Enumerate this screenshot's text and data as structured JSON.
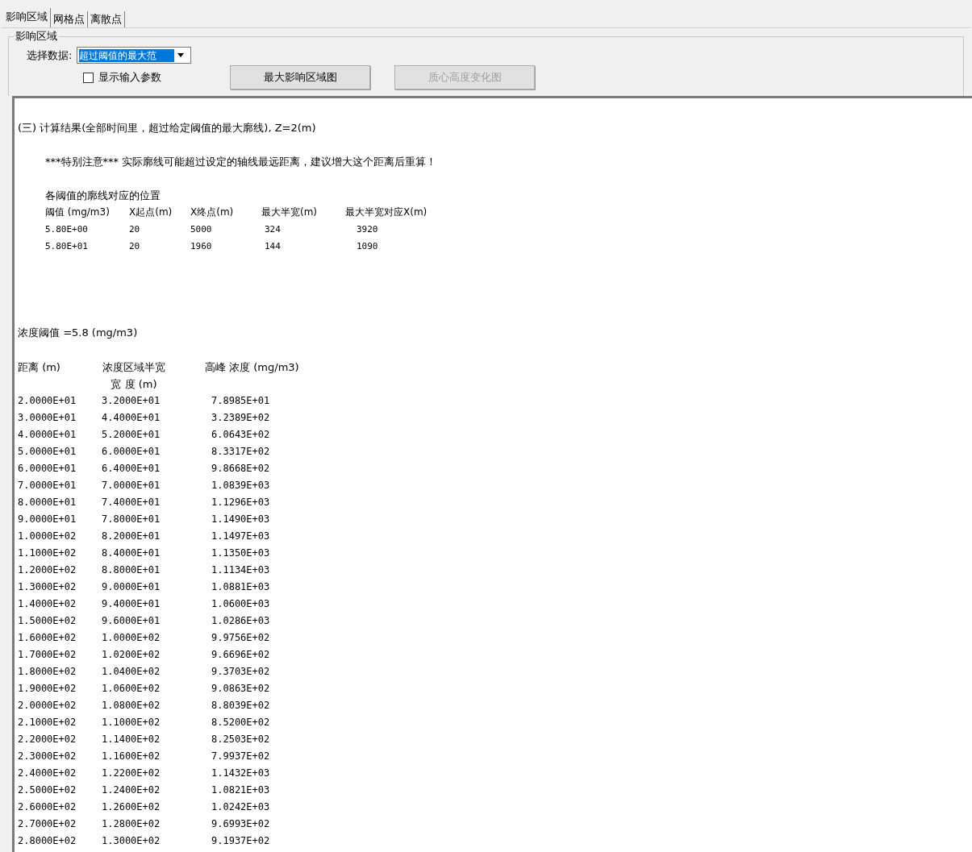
{
  "tabs": [
    {
      "label": "影响区域",
      "selected": true
    },
    {
      "label": "网格点",
      "selected": false
    },
    {
      "label": "离散点",
      "selected": false
    }
  ],
  "group": {
    "title": "影响区域",
    "select_label": "选择数据:",
    "select_value": "超过阈值的最大范",
    "checkbox": {
      "label": "显示输入参数",
      "checked": false
    },
    "buttons": [
      {
        "label": "最大影响区域图",
        "disabled": false
      },
      {
        "label": "质心高度变化图",
        "disabled": true
      }
    ]
  },
  "output": {
    "heading": "(三) 计算结果(全部时间里，超过给定阈值的最大廓线), Z=2(m)",
    "note": "***特别注意*** 实际廓线可能超过设定的轴线最远距离，建议增大这个距离后重算！",
    "threshold_table": {
      "title": "各阈值的廓线对应的位置",
      "columns": [
        "阈值 (mg/m3)",
        "X起点(m)",
        "X终点(m)",
        "最大半宽(m)",
        "最大半宽对应X(m)"
      ],
      "rows": [
        [
          "5.80E+00",
          "20",
          "5000",
          "324",
          "3920"
        ],
        [
          "5.80E+01",
          "20",
          "1960",
          "144",
          "1090"
        ]
      ]
    },
    "concentration_title": "浓度阈值 =5.8 (mg/m3)",
    "concentration_table": {
      "columns": [
        "距离 (m)",
        "浓度区域半宽宽 度 (m)",
        "高峰 浓度 (mg/m3)"
      ],
      "rows": [
        [
          "2.0000E+01",
          "3.2000E+01",
          "7.8985E+01"
        ],
        [
          "3.0000E+01",
          "4.4000E+01",
          "3.2389E+02"
        ],
        [
          "4.0000E+01",
          "5.2000E+01",
          "6.0643E+02"
        ],
        [
          "5.0000E+01",
          "6.0000E+01",
          "8.3317E+02"
        ],
        [
          "6.0000E+01",
          "6.4000E+01",
          "9.8668E+02"
        ],
        [
          "7.0000E+01",
          "7.0000E+01",
          "1.0839E+03"
        ],
        [
          "8.0000E+01",
          "7.4000E+01",
          "1.1296E+03"
        ],
        [
          "9.0000E+01",
          "7.8000E+01",
          "1.1490E+03"
        ],
        [
          "1.0000E+02",
          "8.2000E+01",
          "1.1497E+03"
        ],
        [
          "1.1000E+02",
          "8.4000E+01",
          "1.1350E+03"
        ],
        [
          "1.2000E+02",
          "8.8000E+01",
          "1.1134E+03"
        ],
        [
          "1.3000E+02",
          "9.0000E+01",
          "1.0881E+03"
        ],
        [
          "1.4000E+02",
          "9.4000E+01",
          "1.0600E+03"
        ],
        [
          "1.5000E+02",
          "9.6000E+01",
          "1.0286E+03"
        ],
        [
          "1.6000E+02",
          "1.0000E+02",
          "9.9756E+02"
        ],
        [
          "1.7000E+02",
          "1.0200E+02",
          "9.6696E+02"
        ],
        [
          "1.8000E+02",
          "1.0400E+02",
          "9.3703E+02"
        ],
        [
          "1.9000E+02",
          "1.0600E+02",
          "9.0863E+02"
        ],
        [
          "2.0000E+02",
          "1.0800E+02",
          "8.8039E+02"
        ],
        [
          "2.1000E+02",
          "1.1000E+02",
          "8.5200E+02"
        ],
        [
          "2.2000E+02",
          "1.1400E+02",
          "8.2503E+02"
        ],
        [
          "2.3000E+02",
          "1.1600E+02",
          "7.9937E+02"
        ],
        [
          "2.4000E+02",
          "1.2200E+02",
          "1.1432E+03"
        ],
        [
          "2.5000E+02",
          "1.2400E+02",
          "1.0821E+03"
        ],
        [
          "2.6000E+02",
          "1.2600E+02",
          "1.0242E+03"
        ],
        [
          "2.7000E+02",
          "1.2800E+02",
          "9.6993E+02"
        ],
        [
          "2.8000E+02",
          "1.3000E+02",
          "9.1937E+02"
        ]
      ]
    }
  }
}
